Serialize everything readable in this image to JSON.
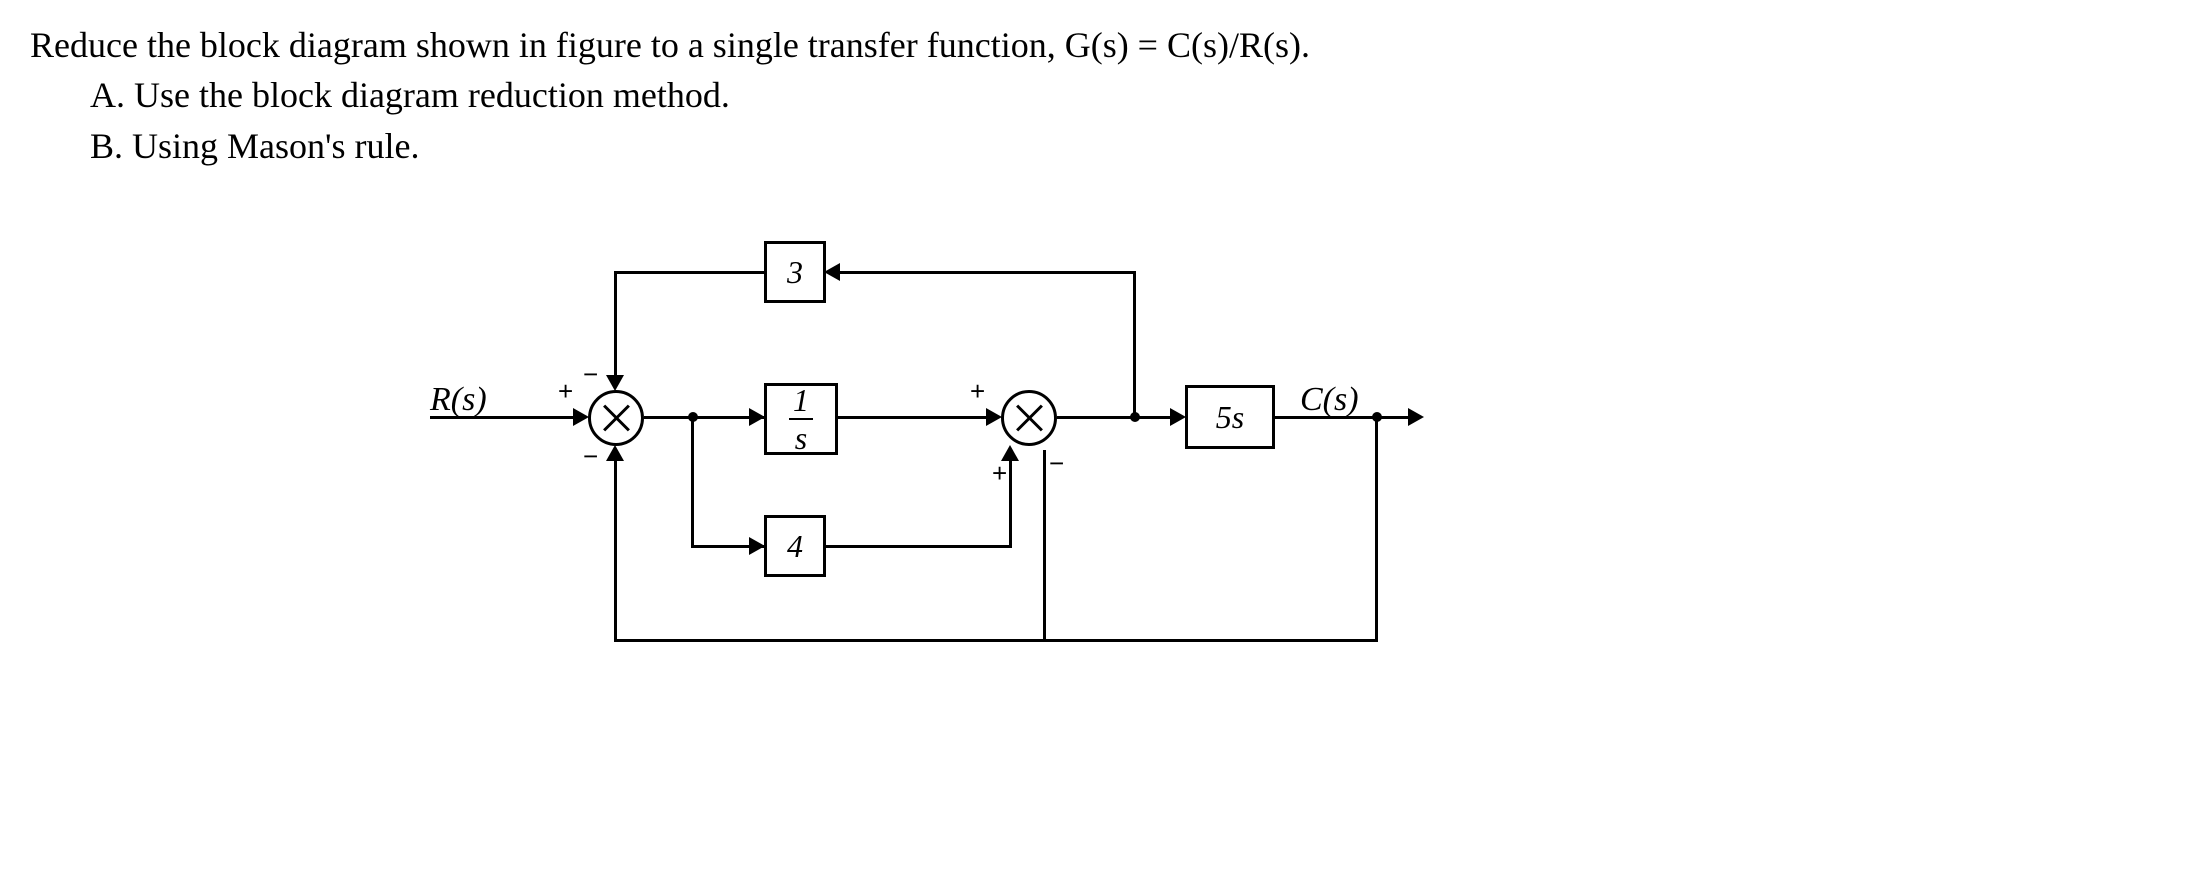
{
  "problem": {
    "main": "Reduce the block diagram shown in figure to a single transfer function, G(s) = C(s)/R(s).",
    "partA": "A. Use the block diagram reduction method.",
    "partB": "B. Using Mason's rule."
  },
  "diagram": {
    "input_label": "R(s)",
    "output_label": "C(s)",
    "block_top": "3",
    "block_mid_num": "1",
    "block_mid_den": "s",
    "block_bottom": "4",
    "block_right": "5s",
    "sign_sum1_in": "+",
    "sign_sum1_top": "−",
    "sign_sum1_bot": "−",
    "sign_sum2_top": "+",
    "sign_sum2_bot_left": "+",
    "sign_sum2_bot_right": "−"
  }
}
